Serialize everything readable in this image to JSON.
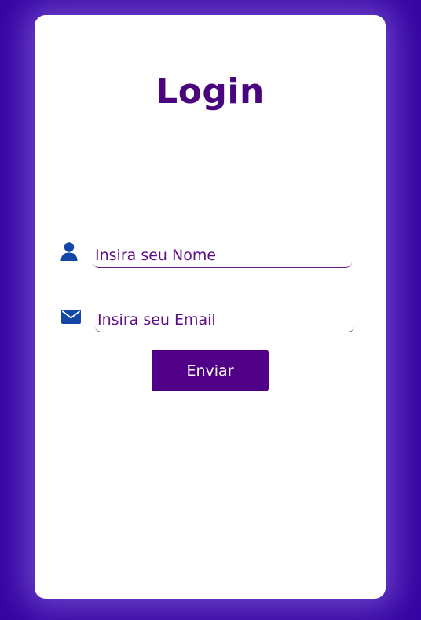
{
  "login": {
    "title": "Login",
    "name_field": {
      "placeholder": "Insira seu Nome",
      "icon": "user-icon"
    },
    "email_field": {
      "placeholder": "Insira seu Email",
      "icon": "envelope-icon"
    },
    "submit_label": "Enviar"
  },
  "colors": {
    "page_background": "#3505a3",
    "card_background": "#ffffff",
    "title": "#4a047d",
    "icon": "#1247a8",
    "field_text": "#5d0c85",
    "button_background": "#4f0086",
    "button_text": "#ffffff"
  }
}
